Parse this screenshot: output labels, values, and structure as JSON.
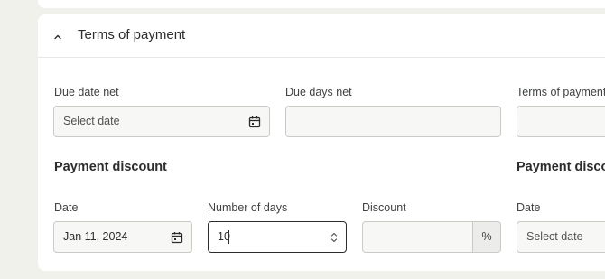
{
  "section": {
    "title": "Terms of payment",
    "expanded": true,
    "toggle_icon": "chevron-up-icon"
  },
  "due_date_net": {
    "label": "Due date net",
    "placeholder": "Select date",
    "icon": "calendar-icon"
  },
  "due_days_net": {
    "label": "Due days net",
    "value": ""
  },
  "terms_of_payment": {
    "label": "Terms of payment"
  },
  "payment_discount_1": {
    "heading": "Payment discount",
    "date": {
      "label": "Date",
      "value": "Jan 11, 2024",
      "icon": "calendar-icon"
    },
    "days": {
      "label": "Number of days",
      "value": "10",
      "icon": "stepper-icon"
    },
    "discount": {
      "label": "Discount",
      "value": "",
      "suffix": "%"
    }
  },
  "payment_discount_2": {
    "heading": "Payment disco",
    "date": {
      "label": "Date",
      "placeholder": "Select date"
    }
  },
  "colors": {
    "background": "#f1f1ec",
    "card": "#ffffff",
    "field": "#f7f7f6",
    "border": "#c9cbc6",
    "text": "#2b2d2c"
  }
}
